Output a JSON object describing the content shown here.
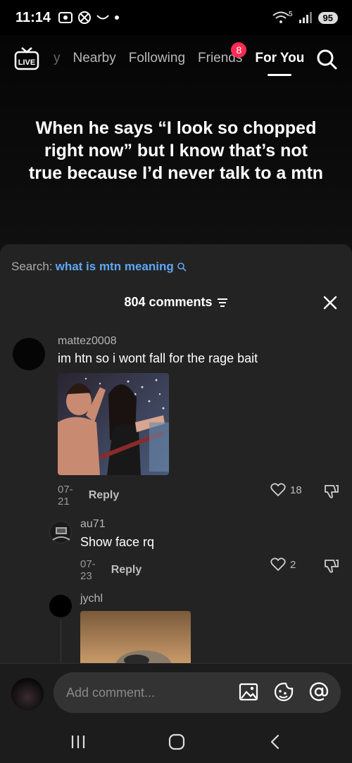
{
  "status_bar": {
    "time": "11:14",
    "battery": "95",
    "signal_label": "5"
  },
  "top_nav": {
    "live_label": "LIVE",
    "tabs": [
      {
        "label": "y"
      },
      {
        "label": "Nearby"
      },
      {
        "label": "Following"
      },
      {
        "label": "Friends",
        "badge": "8"
      },
      {
        "label": "For You",
        "active": true
      }
    ]
  },
  "video": {
    "caption": "When he says “I look so chopped right now” but I know that’s not true because I’d never talk to a mtn"
  },
  "comments_sheet": {
    "search_prefix": "Search:",
    "search_query": "what is mtn meaning",
    "count_label": "804 comments",
    "comments": [
      {
        "username": "mattez0008",
        "text": "im htn so i wont fall for the rage bait",
        "date": "07-21",
        "reply_label": "Reply",
        "likes": "18",
        "has_image": true
      },
      {
        "username": "au71",
        "text": "Show face rq",
        "date": "07-23",
        "reply_label": "Reply",
        "likes": "2"
      },
      {
        "username": "jychl",
        "has_image": true
      }
    ]
  },
  "input_bar": {
    "placeholder": "Add comment..."
  },
  "colors": {
    "accent": "#fe2c55",
    "link": "#5da8f5",
    "sheet_bg": "#232323"
  }
}
